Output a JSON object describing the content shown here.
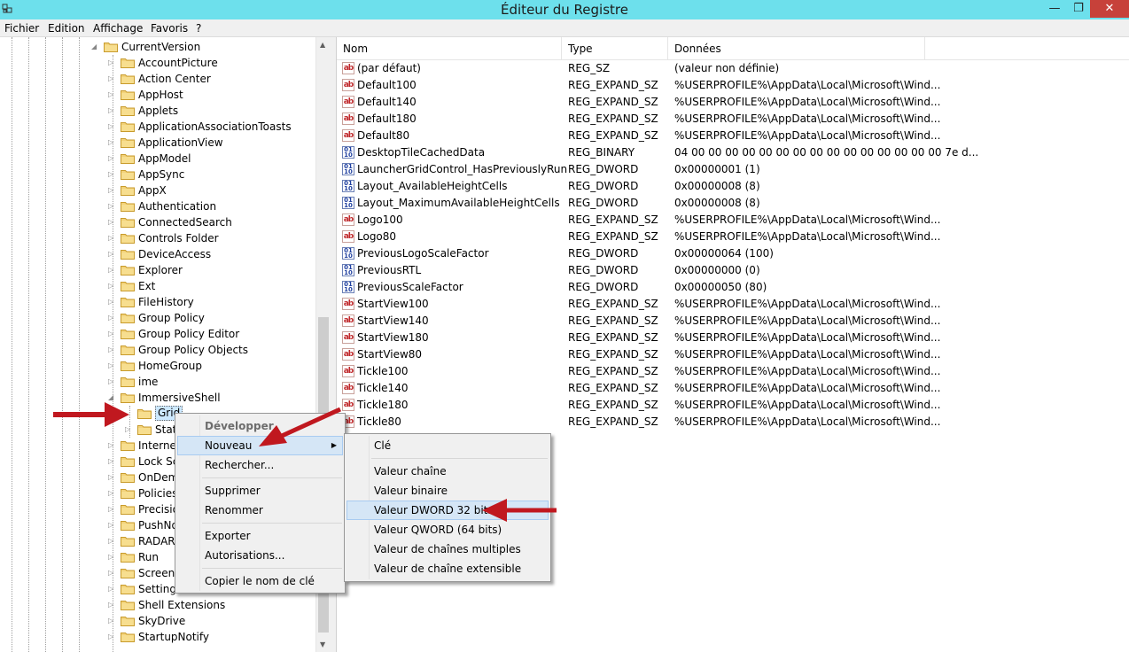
{
  "window": {
    "title": "Éditeur du Registre",
    "minimize": "—",
    "maximize": "❐",
    "close": "✕"
  },
  "menu": [
    "Fichier",
    "Edition",
    "Affichage",
    "Favoris",
    "?"
  ],
  "tree": {
    "parent": "CurrentVersion",
    "items": [
      "AccountPicture",
      "Action Center",
      "AppHost",
      "Applets",
      "ApplicationAssociationToasts",
      "ApplicationView",
      "AppModel",
      "AppSync",
      "AppX",
      "Authentication",
      "ConnectedSearch",
      "Controls Folder",
      "DeviceAccess",
      "Explorer",
      "Ext",
      "FileHistory",
      "Group Policy",
      "Group Policy Editor",
      "Group Policy Objects",
      "HomeGroup",
      "ime",
      "ImmersiveShell"
    ],
    "children": [
      "Grid",
      "Stat"
    ],
    "after": [
      "Interne",
      "Lock Sc",
      "OnDem",
      "Policies",
      "Precisio",
      "PushNo",
      "RADAR",
      "Run",
      "Screens",
      "Setting",
      "Shell Extensions",
      "SkyDrive",
      "StartupNotify"
    ]
  },
  "list": {
    "columns": [
      "Nom",
      "Type",
      "Données"
    ],
    "rows": [
      {
        "icon": "string",
        "name": "(par défaut)",
        "type": "REG_SZ",
        "data": "(valeur non définie)"
      },
      {
        "icon": "string",
        "name": "Default100",
        "type": "REG_EXPAND_SZ",
        "data": "%USERPROFILE%\\AppData\\Local\\Microsoft\\Wind..."
      },
      {
        "icon": "string",
        "name": "Default140",
        "type": "REG_EXPAND_SZ",
        "data": "%USERPROFILE%\\AppData\\Local\\Microsoft\\Wind..."
      },
      {
        "icon": "string",
        "name": "Default180",
        "type": "REG_EXPAND_SZ",
        "data": "%USERPROFILE%\\AppData\\Local\\Microsoft\\Wind..."
      },
      {
        "icon": "string",
        "name": "Default80",
        "type": "REG_EXPAND_SZ",
        "data": "%USERPROFILE%\\AppData\\Local\\Microsoft\\Wind..."
      },
      {
        "icon": "binary",
        "name": "DesktopTileCachedData",
        "type": "REG_BINARY",
        "data": "04 00 00 00 00 00 00 00 00 00 00 00 00 00 00 00 7e d..."
      },
      {
        "icon": "binary",
        "name": "LauncherGridControl_HasPreviouslyRun",
        "type": "REG_DWORD",
        "data": "0x00000001 (1)"
      },
      {
        "icon": "binary",
        "name": "Layout_AvailableHeightCells",
        "type": "REG_DWORD",
        "data": "0x00000008 (8)"
      },
      {
        "icon": "binary",
        "name": "Layout_MaximumAvailableHeightCells",
        "type": "REG_DWORD",
        "data": "0x00000008 (8)"
      },
      {
        "icon": "string",
        "name": "Logo100",
        "type": "REG_EXPAND_SZ",
        "data": "%USERPROFILE%\\AppData\\Local\\Microsoft\\Wind..."
      },
      {
        "icon": "string",
        "name": "Logo80",
        "type": "REG_EXPAND_SZ",
        "data": "%USERPROFILE%\\AppData\\Local\\Microsoft\\Wind..."
      },
      {
        "icon": "binary",
        "name": "PreviousLogoScaleFactor",
        "type": "REG_DWORD",
        "data": "0x00000064 (100)"
      },
      {
        "icon": "binary",
        "name": "PreviousRTL",
        "type": "REG_DWORD",
        "data": "0x00000000 (0)"
      },
      {
        "icon": "binary",
        "name": "PreviousScaleFactor",
        "type": "REG_DWORD",
        "data": "0x00000050 (80)"
      },
      {
        "icon": "string",
        "name": "StartView100",
        "type": "REG_EXPAND_SZ",
        "data": "%USERPROFILE%\\AppData\\Local\\Microsoft\\Wind..."
      },
      {
        "icon": "string",
        "name": "StartView140",
        "type": "REG_EXPAND_SZ",
        "data": "%USERPROFILE%\\AppData\\Local\\Microsoft\\Wind..."
      },
      {
        "icon": "string",
        "name": "StartView180",
        "type": "REG_EXPAND_SZ",
        "data": "%USERPROFILE%\\AppData\\Local\\Microsoft\\Wind..."
      },
      {
        "icon": "string",
        "name": "StartView80",
        "type": "REG_EXPAND_SZ",
        "data": "%USERPROFILE%\\AppData\\Local\\Microsoft\\Wind..."
      },
      {
        "icon": "string",
        "name": "Tickle100",
        "type": "REG_EXPAND_SZ",
        "data": "%USERPROFILE%\\AppData\\Local\\Microsoft\\Wind..."
      },
      {
        "icon": "string",
        "name": "Tickle140",
        "type": "REG_EXPAND_SZ",
        "data": "%USERPROFILE%\\AppData\\Local\\Microsoft\\Wind..."
      },
      {
        "icon": "string",
        "name": "Tickle180",
        "type": "REG_EXPAND_SZ",
        "data": "%USERPROFILE%\\AppData\\Local\\Microsoft\\Wind..."
      },
      {
        "icon": "string",
        "name": "Tickle80",
        "type": "REG_EXPAND_SZ",
        "data": "%USERPROFILE%\\AppData\\Local\\Microsoft\\Wind..."
      }
    ]
  },
  "context_menu": {
    "expand": "Développer",
    "new": "Nouveau",
    "find": "Rechercher...",
    "delete": "Supprimer",
    "rename": "Renommer",
    "export": "Exporter",
    "permissions": "Autorisations...",
    "copy_key_name": "Copier le nom de clé"
  },
  "submenu": {
    "key": "Clé",
    "string_value": "Valeur chaîne",
    "binary_value": "Valeur binaire",
    "dword_value": "Valeur DWORD 32 bits",
    "qword_value": "Valeur QWORD (64 bits)",
    "multi_string_value": "Valeur de chaînes multiples",
    "expandable_string_value": "Valeur de chaîne extensible"
  },
  "colors": {
    "titlebar": "#6de0ec",
    "close_button": "#c7413a",
    "selection": "#cce8ff",
    "menu_highlight": "#d5e6f6",
    "annotation_arrow": "#c0181f"
  }
}
